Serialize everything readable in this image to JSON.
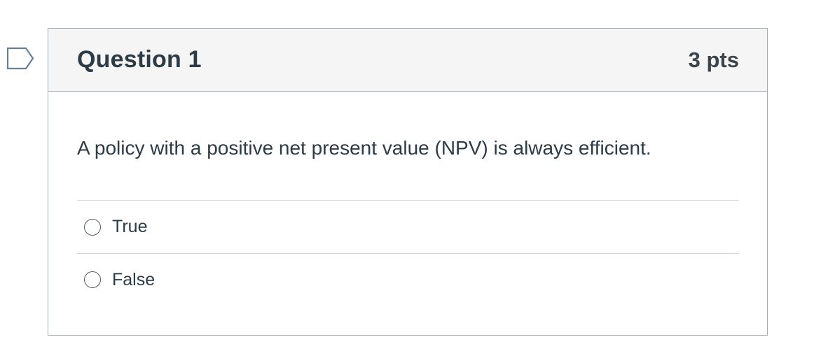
{
  "question": {
    "title": "Question 1",
    "points": "3 pts",
    "text": "A policy with a positive net present value (NPV) is always efficient.",
    "answers": [
      {
        "label": "True",
        "selected": false
      },
      {
        "label": "False",
        "selected": false
      }
    ]
  },
  "icons": {
    "flag": "flag-icon",
    "radio": "radio-unchecked-icon"
  },
  "colors": {
    "header_bg": "#f5f5f5",
    "border": "#a7acb0",
    "text": "#2d3b45",
    "flag": "#6b7f91"
  }
}
